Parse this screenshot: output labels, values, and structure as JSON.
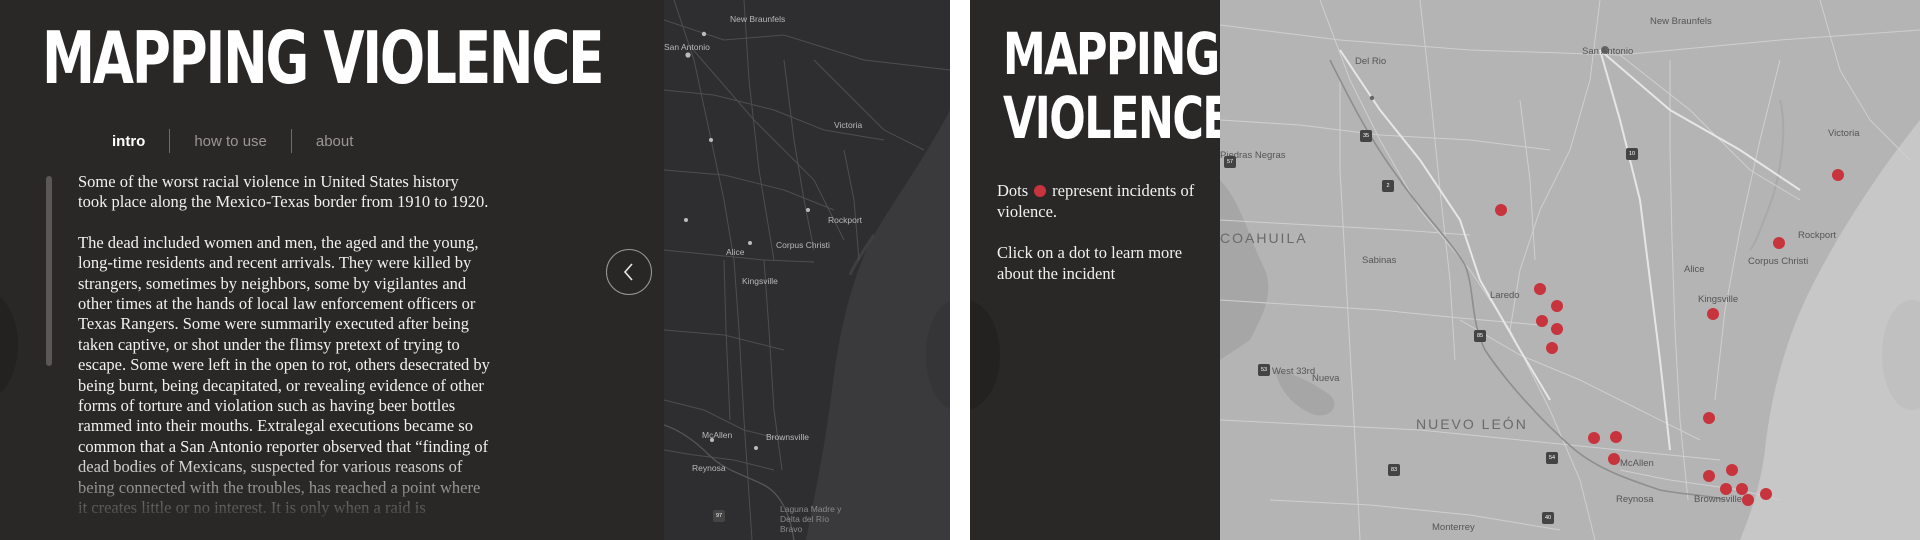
{
  "left": {
    "title": "MAPPING VIOLENCE",
    "tabs": [
      {
        "label": "intro",
        "active": true
      },
      {
        "label": "how to use",
        "active": false
      },
      {
        "label": "about",
        "active": false
      }
    ],
    "paragraphs": [
      "Some of the worst racial violence in United States history took place along the Mexico-Texas border from 1910 to 1920.",
      "The dead included women and men, the aged and the young, long-time residents and recent arrivals. They were killed by strangers, sometimes by neighbors, some by vigilantes and other times at the hands of local law enforcement officers or Texas Rangers. Some were summarily executed after being taken captive, or shot under the flimsy pretext of trying to escape. Some were left in the open to rot, others desecrated by being burnt, being decapitated, or revealing evidence of other forms of torture and violation such as having beer bottles rammed into their mouths. Extralegal executions became so common that a San Antonio reporter observed that “finding of dead bodies of Mexicans, suspected for various reasons of being connected with the troubles, has reached a point where it creates little or no interest. It is only when a raid is"
    ],
    "map_labels": {
      "new_braunfels": "New Braunfels",
      "san_antonio": "San Antonio",
      "victoria": "Victoria",
      "rockport": "Rockport",
      "corpus_christi": "Corpus Christi",
      "alice": "Alice",
      "kingsville": "Kingsville",
      "mcallen": "McAllen",
      "reynosa": "Reynosa",
      "brownsville": "Brownsville",
      "laguna_madre": "Laguna Madre y Delta del Río Bravo",
      "hw97": "97"
    },
    "back_icon": "chevron-left-icon"
  },
  "right": {
    "title_line1": "MAPPING",
    "title_line2": "VIOLENCE",
    "legend_before": "Dots",
    "legend_after": "represent incidents of violence.",
    "instruction": "Click on a dot to learn more about the incident",
    "dot_color": "#c8343e",
    "map_labels": {
      "new_braunfels": "New Braunfels",
      "san_antonio": "San Antonio",
      "del_rio": "Del Rio",
      "piedras_negras": "Piedras Negras",
      "coahuila": "COAHUILA",
      "sabinas": "Sabinas",
      "victoria": "Victoria",
      "rockport": "Rockport",
      "corpus_christi": "Corpus Christi",
      "alice": "Alice",
      "kingsville": "Kingsville",
      "laredo": "Laredo",
      "west_33rd": "West 33rd",
      "nueva": "Nueva",
      "nuevo_leon": "NUEVO LEÓN",
      "mcallen": "McAllen",
      "reynosa": "Reynosa",
      "brownsville": "Brownsville",
      "monterrey": "Monterrey"
    },
    "highway_labels": [
      "10",
      "35",
      "37",
      "57",
      "2",
      "85",
      "53",
      "54",
      "40",
      "83"
    ]
  }
}
